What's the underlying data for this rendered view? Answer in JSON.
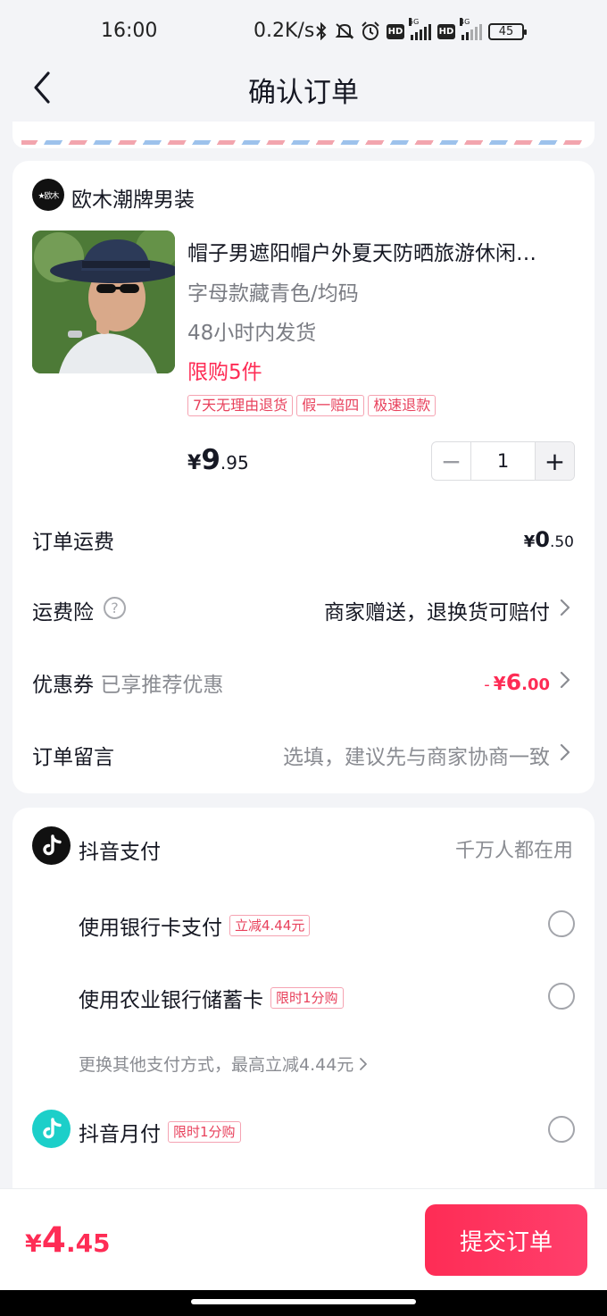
{
  "status": {
    "time": "16:00",
    "network_speed": "0.2K/s",
    "sim1_label": "5G",
    "sim2_label": "4G",
    "hd_label": "HD",
    "battery": "45"
  },
  "header": {
    "title": "确认订单",
    "back_icon": "chevron-left-icon"
  },
  "shop": {
    "name": "欧木潮牌男装",
    "logo_text": "★欧木"
  },
  "product": {
    "title": "帽子男遮阳帽户外夏天防晒旅游休闲…",
    "spec": "字母款藏青色/均码",
    "shipping": "48小时内发货",
    "limit": "限购5件",
    "badges": [
      "7天无理由退货",
      "假一赔四",
      "极速退款"
    ],
    "price": {
      "symbol": "¥",
      "integer": "9",
      "decimal": ".95"
    },
    "quantity": "1",
    "minus": "−",
    "plus": "+"
  },
  "rows": {
    "freight": {
      "label": "订单运费",
      "symbol": "¥",
      "integer": "0",
      "decimal": ".50"
    },
    "insurance": {
      "label": "运费险",
      "help": "?",
      "value": "商家赠送，退换货可赔付"
    },
    "coupon": {
      "label": "优惠券",
      "sub": "已享推荐优惠",
      "minus": "-",
      "symbol": "¥",
      "integer": "6",
      "decimal": ".00"
    },
    "message": {
      "label": "订单留言",
      "placeholder": "选填，建议先与商家协商一致"
    }
  },
  "payment": {
    "douyin_pay": {
      "label": "抖音支付",
      "tagline": "千万人都在用"
    },
    "options": [
      {
        "label": "使用银行卡支付",
        "promo": "立减4.44元"
      },
      {
        "label": "使用农业银行储蓄卡",
        "promo": "限时1分购"
      }
    ],
    "more": "更换其他支付方式，最高立减4.44元",
    "monthly": {
      "label": "抖音月付",
      "promo": "限时1分购"
    }
  },
  "footer": {
    "total": {
      "symbol": "¥",
      "integer": "4",
      "decimal": ".45"
    },
    "submit_label": "提交订单"
  },
  "colors": {
    "accent": "#fe2c55",
    "background": "#f3f4f7",
    "monthly_icon": "#1ccfc9"
  }
}
